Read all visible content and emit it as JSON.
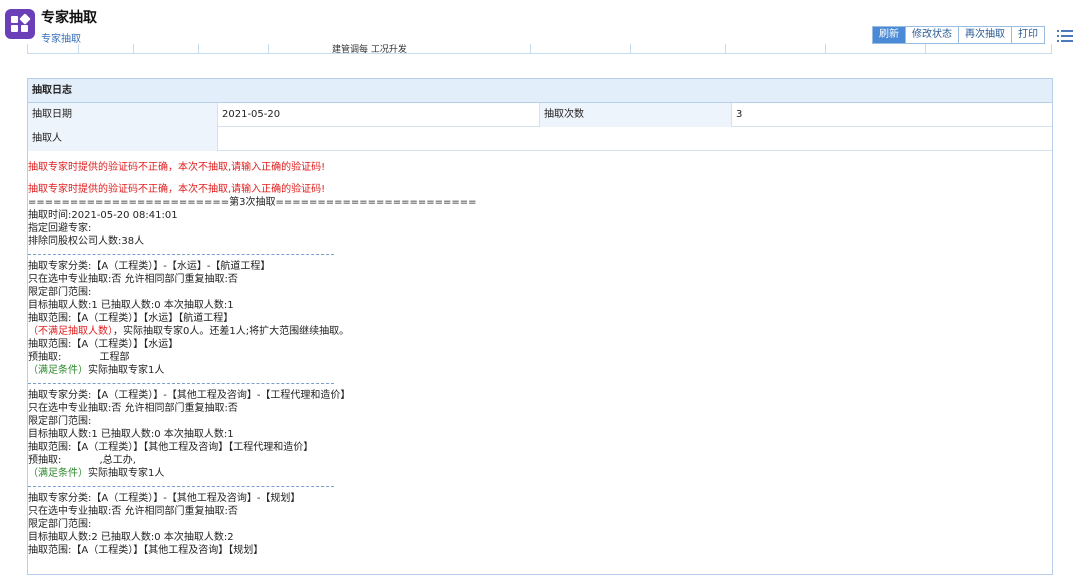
{
  "app": {
    "title": "专家抽取",
    "breadcrumb": "专家抽取"
  },
  "toolbar": {
    "refresh": "刷新",
    "modify_status": "修改状态",
    "redraw": "再次抽取",
    "print": "打印"
  },
  "stub": {
    "partial_text": "建管调每 工况升发"
  },
  "log_panel": {
    "title": "抽取日志",
    "date_label": "抽取日期",
    "date_value": "2021-05-20",
    "count_label": "抽取次数",
    "count_value": "3",
    "person_label": "抽取人",
    "person_value": ""
  },
  "log": {
    "error1": "抽取专家时提供的验证码不正确，本次不抽取,请输入正确的验证码!",
    "error2": "抽取专家时提供的验证码不正确，本次不抽取,请输入正确的验证码!",
    "separator": "========================第3次抽取========================",
    "time": "抽取时间:2021-05-20 08:41:01",
    "avoid": "指定回避专家:",
    "exclude": "排除同股权公司人数:38人",
    "groups": [
      {
        "category": "抽取专家分类:【A（工程类）】-【水运】-【航道工程】",
        "only_major": "只在选中专业抽取:否 允许相同部门重复抽取:否",
        "dept_range": "限定部门范围:",
        "target": "目标抽取人数:1 已抽取人数:0 本次抽取人数:1",
        "range1": "抽取范围:【A（工程类）】【水运】【航道工程】",
        "warn_tag": "（不满足抽取人数）",
        "warn_text": "，实际抽取专家0人。还差1人;将扩大范围继续抽取。",
        "range2": "抽取范围:【A（工程类）】【水运】",
        "pre": "预抽取:            工程部",
        "ok_tag": "（满足条件）",
        "ok_text": "实际抽取专家1人"
      },
      {
        "category": "抽取专家分类:【A（工程类）】-【其他工程及咨询】-【工程代理和造价】",
        "only_major": "只在选中专业抽取:否 允许相同部门重复抽取:否",
        "dept_range": "限定部门范围:",
        "target": "目标抽取人数:1 已抽取人数:0 本次抽取人数:1",
        "range1": "抽取范围:【A（工程类）】【其他工程及咨询】【工程代理和造价】",
        "pre": "预抽取:            ,总工办,",
        "ok_tag": "（满足条件）",
        "ok_text": "实际抽取专家1人"
      },
      {
        "category": "抽取专家分类:【A（工程类）】-【其他工程及咨询】-【规划】",
        "only_major": "只在选中专业抽取:否 允许相同部门重复抽取:否",
        "dept_range": "限定部门范围:",
        "target": "目标抽取人数:2 已抽取人数:0 本次抽取人数:2",
        "range1": "抽取范围:【A（工程类）】【其他工程及咨询】【规划】"
      }
    ]
  }
}
